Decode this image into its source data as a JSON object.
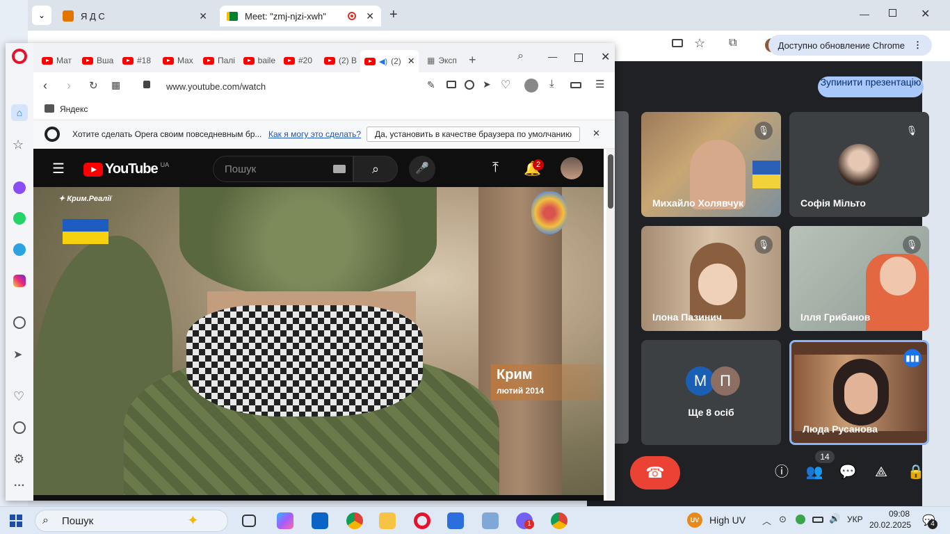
{
  "chrome": {
    "tabs": [
      {
        "label": "Я Д С"
      },
      {
        "label": "Meet: \"zmj-njzi-xwh\""
      }
    ],
    "update_label": "Доступно обновление Chrome"
  },
  "meet": {
    "stop_presenting": "Зупинити презентацію",
    "participants": [
      {
        "name": "Михайло Холявчук",
        "muted": true
      },
      {
        "name": "Софія Мільто",
        "muted": true
      },
      {
        "name": "Ілона Пазинич",
        "muted": true
      },
      {
        "name": "Ілля Грибанов",
        "muted": true
      },
      {
        "name": "Ще 8 осіб",
        "initials": [
          "М",
          "П"
        ]
      },
      {
        "name": "Люда Русанова",
        "speaking": true
      }
    ],
    "participant_count": "14"
  },
  "opera": {
    "tabs": [
      "Мат",
      "Вша",
      "#18",
      "Max",
      "Палі",
      "baile",
      "#20",
      "(2) В",
      "(2)",
      "Эксп"
    ],
    "url": "www.youtube.com/watch",
    "bookmark": "Яндекс",
    "default_prompt": "Хотите сделать Opera своим повседневным бр...",
    "how_link": "Как я могу это сделать?",
    "set_default_btn": "Да, установить в качестве браузера по умолчанию"
  },
  "youtube": {
    "logo": "YouTube",
    "region": "UA",
    "search_placeholder": "Пошук",
    "notif_count": "2"
  },
  "video": {
    "watermark": "Крим.Реалії",
    "caption_title": "Крим",
    "caption_sub": "лютий 2014"
  },
  "taskbar": {
    "search": "Пошук",
    "weather": "High UV",
    "lang": "УКР",
    "time": "09:08",
    "date": "20.02.2025",
    "notif_badge": "4",
    "viber_badge": "1"
  }
}
